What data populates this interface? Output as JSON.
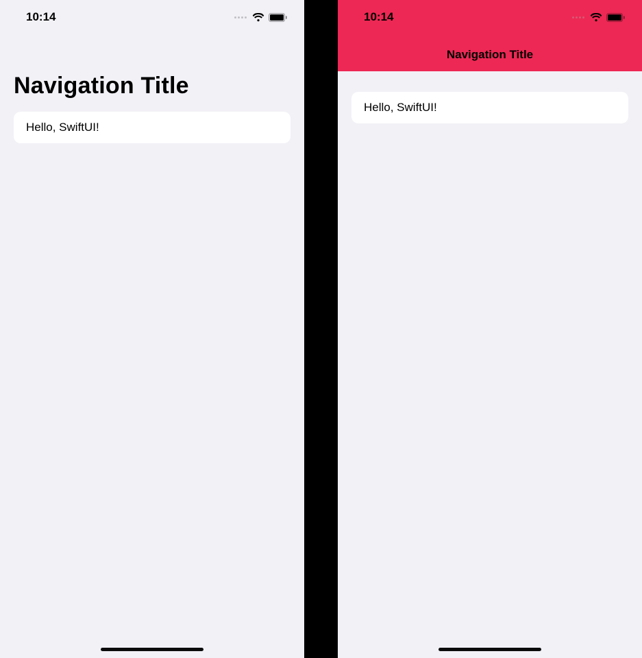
{
  "left": {
    "status_time": "10:14",
    "nav_title": "Navigation Title",
    "cell_text": "Hello, SwiftUI!"
  },
  "right": {
    "status_time": "10:14",
    "nav_title": "Navigation Title",
    "cell_text": "Hello, SwiftUI!",
    "nav_bg_color": "#ed2854"
  }
}
